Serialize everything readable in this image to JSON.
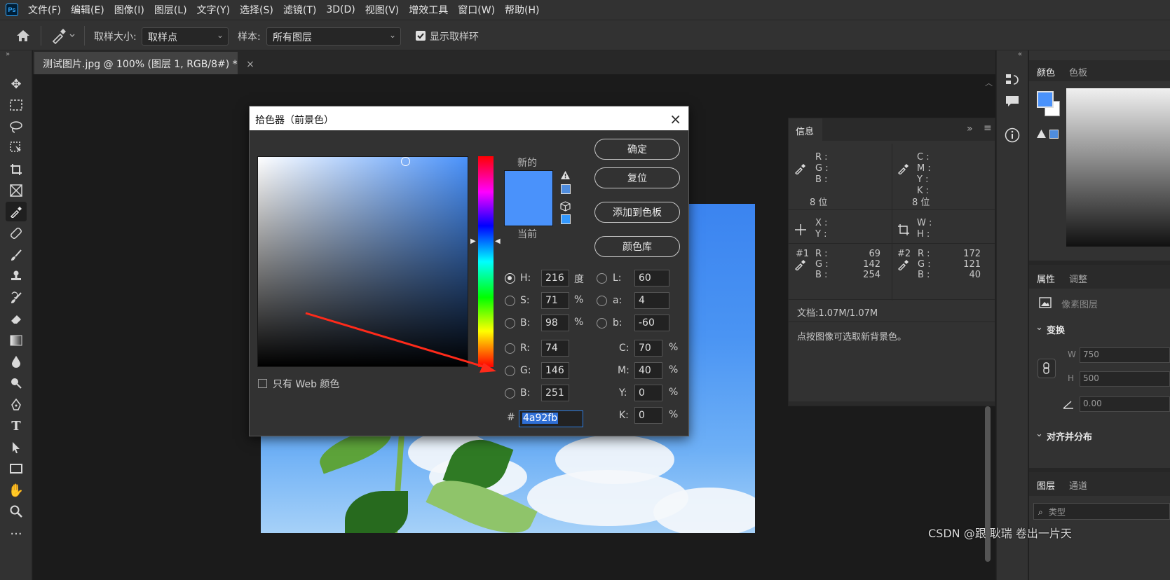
{
  "menu": [
    "文件(F)",
    "编辑(E)",
    "图像(I)",
    "图层(L)",
    "文字(Y)",
    "选择(S)",
    "滤镜(T)",
    "3D(D)",
    "视图(V)",
    "增效工具",
    "窗口(W)",
    "帮助(H)"
  ],
  "app_logo": "Ps",
  "options": {
    "sample_size_label": "取样大小:",
    "sample_size_value": "取样点",
    "sample_label": "样本:",
    "sample_value": "所有图层",
    "show_ring_label": "显示取样环"
  },
  "document_tab": {
    "title": "测试图片.jpg @ 100% (图层 1, RGB/8#) *",
    "close": "×"
  },
  "dialog": {
    "title": "拾色器（前景色）",
    "close": "×",
    "new_label": "新的",
    "current_label": "当前",
    "new_color": "#4a92fb",
    "current_color": "#4a92fb",
    "buttons": {
      "ok": "确定",
      "reset": "复位",
      "add_swatch": "添加到色板",
      "libraries": "颜色库"
    },
    "web_only_label": "只有 Web 颜色",
    "hsb": {
      "h_label": "H:",
      "h_value": "216",
      "h_unit": "度",
      "s_label": "S:",
      "s_value": "71",
      "s_unit": "%",
      "b_label": "B:",
      "b_value": "98",
      "b_unit": "%"
    },
    "lab": {
      "l_label": "L:",
      "l_value": "60",
      "a_label": "a:",
      "a_value": "4",
      "b_label": "b:",
      "b_value": "-60"
    },
    "rgb": {
      "r_label": "R:",
      "r_value": "74",
      "g_label": "G:",
      "g_value": "146",
      "b_label": "B:",
      "b_value": "251"
    },
    "cmyk": {
      "c_label": "C:",
      "c_value": "70",
      "m_label": "M:",
      "m_value": "40",
      "y_label": "Y:",
      "y_value": "0",
      "k_label": "K:",
      "k_value": "0",
      "unit": "%"
    },
    "hex_label": "#",
    "hex_value": "4a92fb"
  },
  "info_panel": {
    "tab": "信息",
    "rgb_letters": [
      "R :",
      "G :",
      "B :"
    ],
    "cmyk_letters": [
      "C :",
      "M :",
      "Y :",
      "K :"
    ],
    "bits_left": "8 位",
    "bits_right": "8 位",
    "xy_letters": [
      "X :",
      "Y :"
    ],
    "wh_letters": [
      "W :",
      "H :"
    ],
    "sample1": {
      "label": "#1",
      "letters": [
        "R :",
        "G :",
        "B :"
      ],
      "values": [
        "69",
        "142",
        "254"
      ]
    },
    "sample2": {
      "label": "#2",
      "letters": [
        "R :",
        "G :",
        "B :"
      ],
      "values": [
        "172",
        "121",
        "40"
      ]
    },
    "doc_size": "文档:1.07M/1.07M",
    "hint": "点按图像可选取新背景色。"
  },
  "right_panels": {
    "color_tabs": [
      "颜色",
      "色板"
    ],
    "props_tabs": [
      "属性",
      "调整"
    ],
    "pixel_layer": "像素图层",
    "transform": "变换",
    "w_label": "W",
    "w_value": "750",
    "h_label": "H",
    "h_value": "500",
    "angle_value": "0.00",
    "align": "对齐并分布",
    "layers_tabs": [
      "图层",
      "通道"
    ],
    "kind_label": "类型"
  },
  "watermark": "CSDN @跟 耿瑞 卷出一片天"
}
